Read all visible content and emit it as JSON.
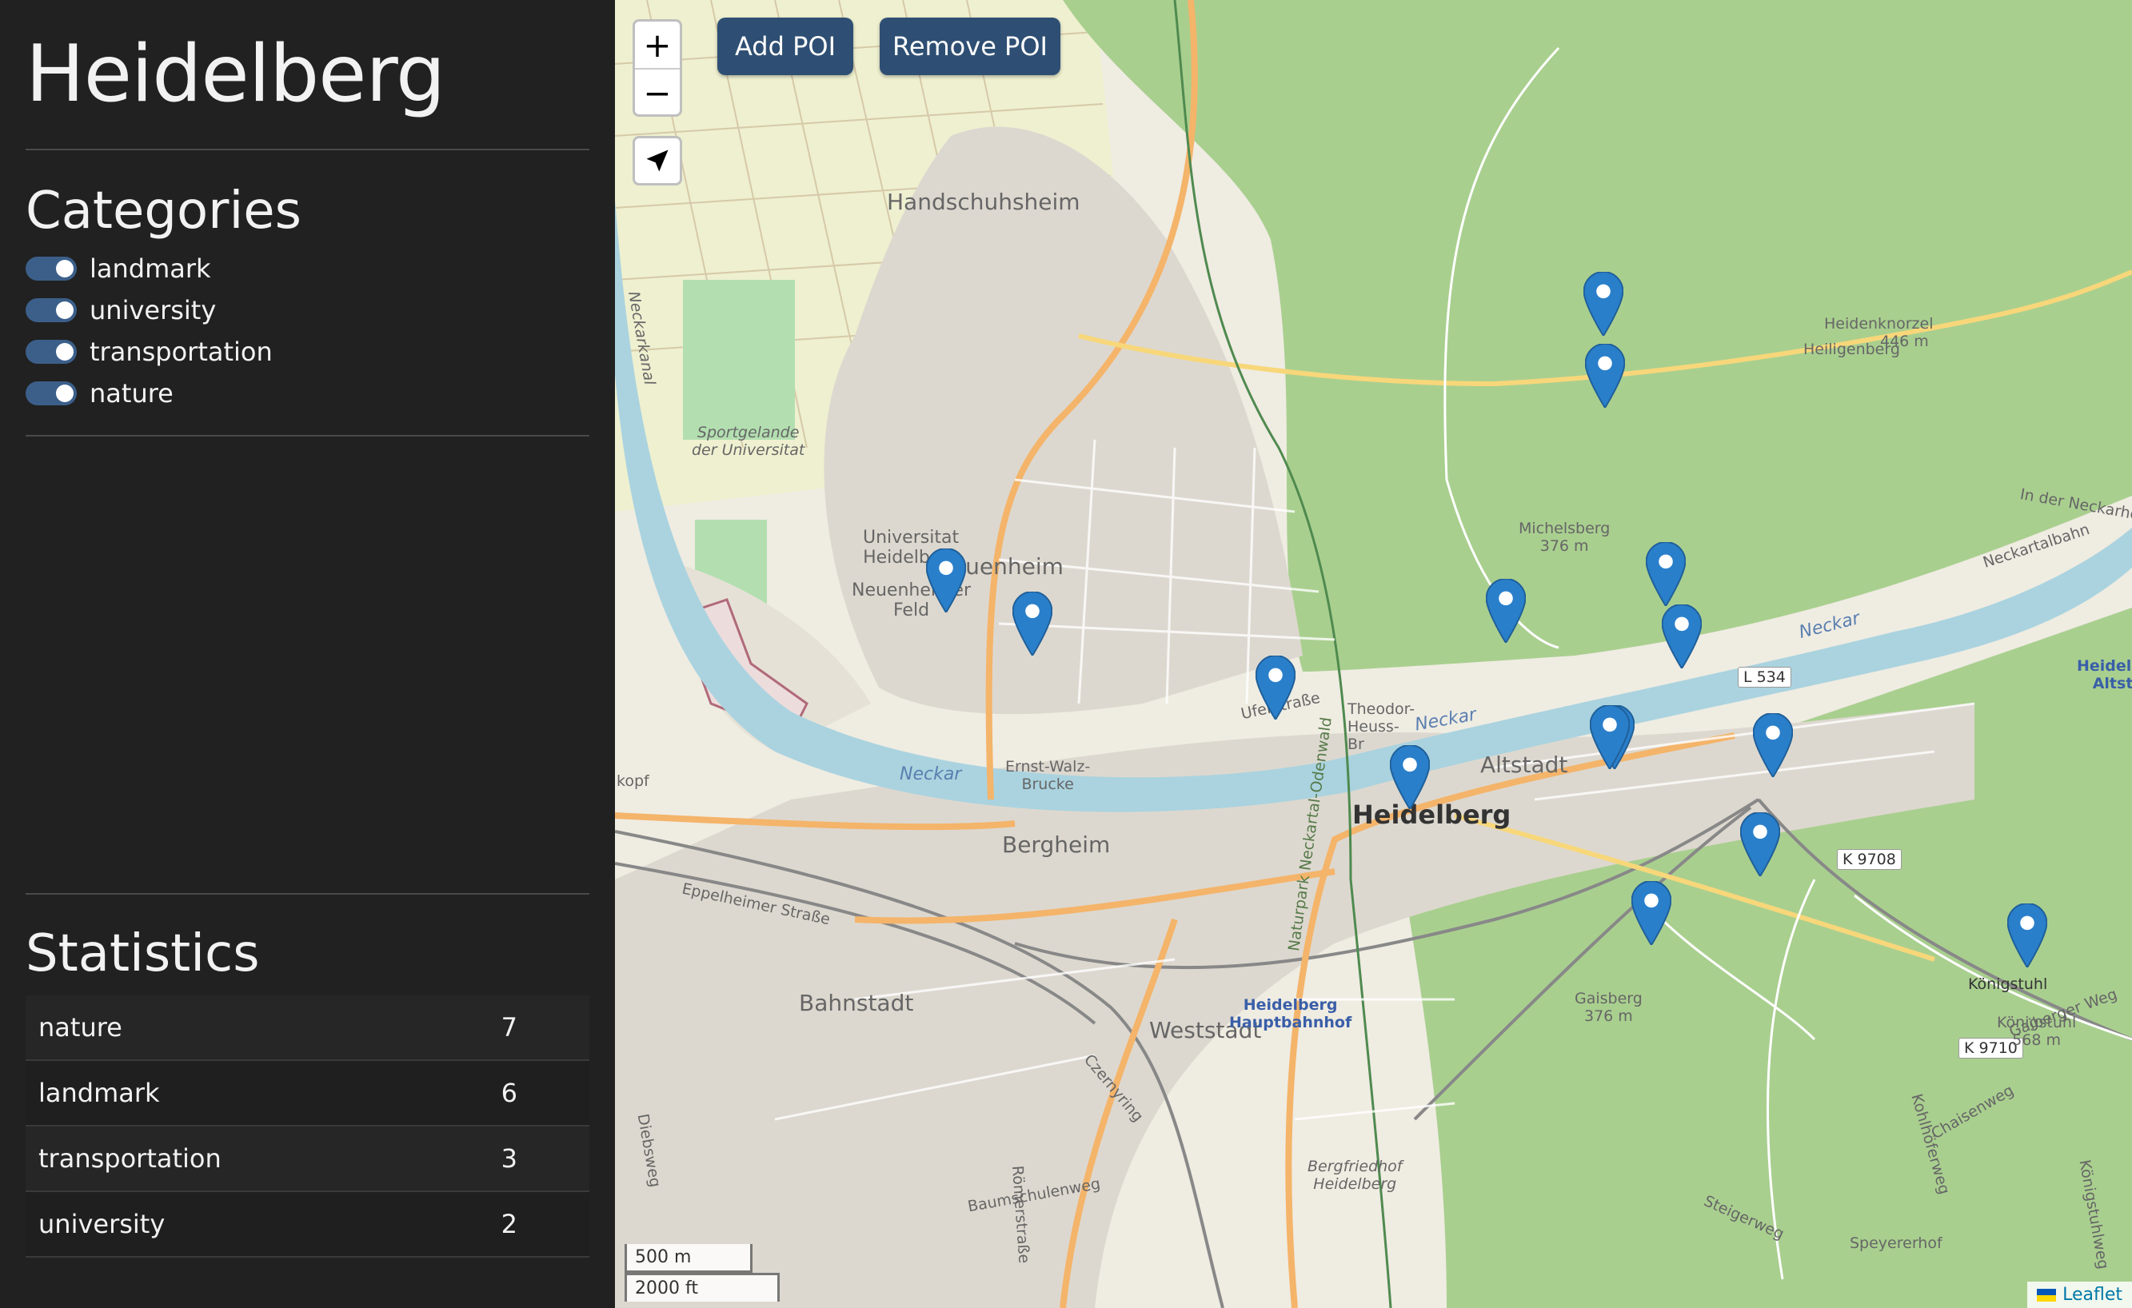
{
  "sidebar": {
    "title": "Heidelberg",
    "categories_title": "Categories",
    "categories": [
      {
        "label": "landmark",
        "enabled": true
      },
      {
        "label": "university",
        "enabled": true
      },
      {
        "label": "transportation",
        "enabled": true
      },
      {
        "label": "nature",
        "enabled": true
      }
    ],
    "statistics_title": "Statistics",
    "statistics": [
      {
        "label": "nature",
        "count": "7"
      },
      {
        "label": "landmark",
        "count": "6"
      },
      {
        "label": "transportation",
        "count": "3"
      },
      {
        "label": "university",
        "count": "2"
      }
    ]
  },
  "map": {
    "zoom_in": "+",
    "zoom_out": "−",
    "locate_icon": "navigation-arrow-icon",
    "add_poi": "Add POI",
    "remove_poi": "Remove POI",
    "scale_metric": "500 m",
    "scale_imperial": "2000 ft",
    "attribution": "Leaflet",
    "marker_color": "#2a7fca",
    "labels": {
      "handschuhsheim": "Handschuhsheim",
      "neuenheim": "Neuenheim",
      "altstadt": "Altstadt",
      "heidelberg": "Heidelberg",
      "bergheim": "Bergheim",
      "bahnstadt": "Bahnstadt",
      "weststadt": "Weststadt",
      "neckar1": "Neckar",
      "neckar2": "Neckar",
      "neckar3": "Neckar",
      "l534": "L 534",
      "k9708": "K 9708",
      "k9710": "K 9710",
      "heidenknorzel": "Heidenknorzel",
      "heidenknorzel_h": "446 m",
      "michelsberg": "Michelsberg",
      "michelsberg_h": "376 m",
      "gaisberg": "Gaisberg",
      "gaisberg_h": "376 m",
      "konigstuhl": "Königstuhl",
      "konigstuhl2": "Königstuhl",
      "konigstuhl_h": "568 m",
      "heiligenberg": "Heiligenberg",
      "hbf1": "Heidelberg",
      "hbf2": "Hauptbahnhof",
      "altstadt_station1": "Heidelberg-",
      "altstadt_station2": "Altstadt",
      "uni1": "Universitat",
      "uni2": "Heidelberg",
      "neuenheimer_feld1": "Neuenheimer",
      "neuenheimer_feld2": "Feld",
      "sportgelande1": "Sportgelande",
      "sportgelande2": "der Universitat",
      "ernst_walz1": "Ernst-Walz-",
      "ernst_walz2": "Brucke",
      "theodor1": "Theodor-",
      "theodor2": "Heuss-",
      "theodor3": "Br",
      "uferstrasse": "Uferstraße",
      "eppelheimer": "Eppelheimer Straße",
      "czernyring": "Czernyring",
      "romerstrasse": "Römerstraße",
      "naturpark": "Naturpark Neckartal-Odenwald",
      "bergfriedhof1": "Bergfriedhof",
      "bergfriedhof2": "Heidelberg",
      "baumschulenweg": "Baumschulenweg",
      "steigerweg": "Steigerweg",
      "speyererhof": "Speyererhof",
      "gaiberger": "Gaiberger Weg",
      "kohlhofer": "Kohlhöferweg",
      "chaisenweg": "Chaisenweg",
      "konigstuhlweg": "Königstuhlweg",
      "neckarkanal": "Neckarkanal",
      "diebsweg": "Diebsweg",
      "neckarbahn": "Neckartalbahn",
      "in_der_neckarhelle": "In der Neckarhelle",
      "kopf": "kopf"
    }
  }
}
